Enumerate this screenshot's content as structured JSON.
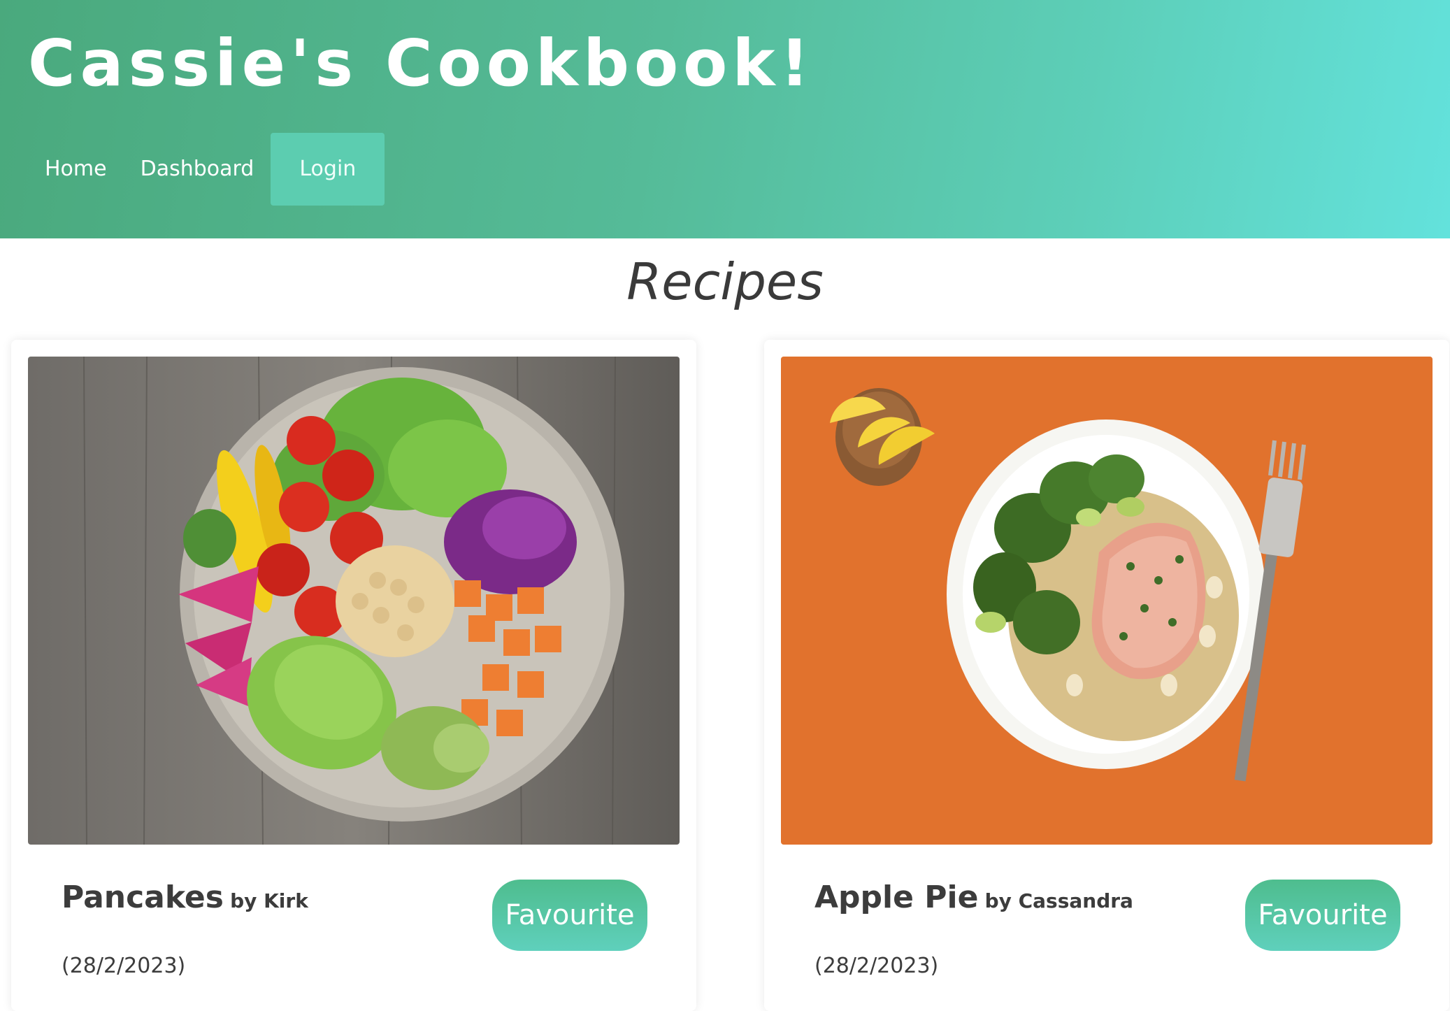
{
  "header": {
    "title": "Cassie's Cookbook!",
    "nav": [
      {
        "label": "Home",
        "active": false
      },
      {
        "label": "Dashboard",
        "active": false
      },
      {
        "label": "Login",
        "active": true
      }
    ]
  },
  "main": {
    "title": "Recipes",
    "recipes": [
      {
        "name": "Pancakes",
        "author": "by Kirk",
        "date": "(28/2/2023)",
        "favourite_label": "Favourite"
      },
      {
        "name": "Apple Pie",
        "author": "by Cassandra",
        "date": "(28/2/2023)",
        "favourite_label": "Favourite"
      }
    ]
  },
  "colors": {
    "header_gradient_start": "#4aa97d",
    "header_gradient_end": "#63e2dc",
    "active_nav_bg": "#5ccdb0",
    "button_gradient_start": "#4ebd8e",
    "button_gradient_end": "#5fd0bc"
  }
}
